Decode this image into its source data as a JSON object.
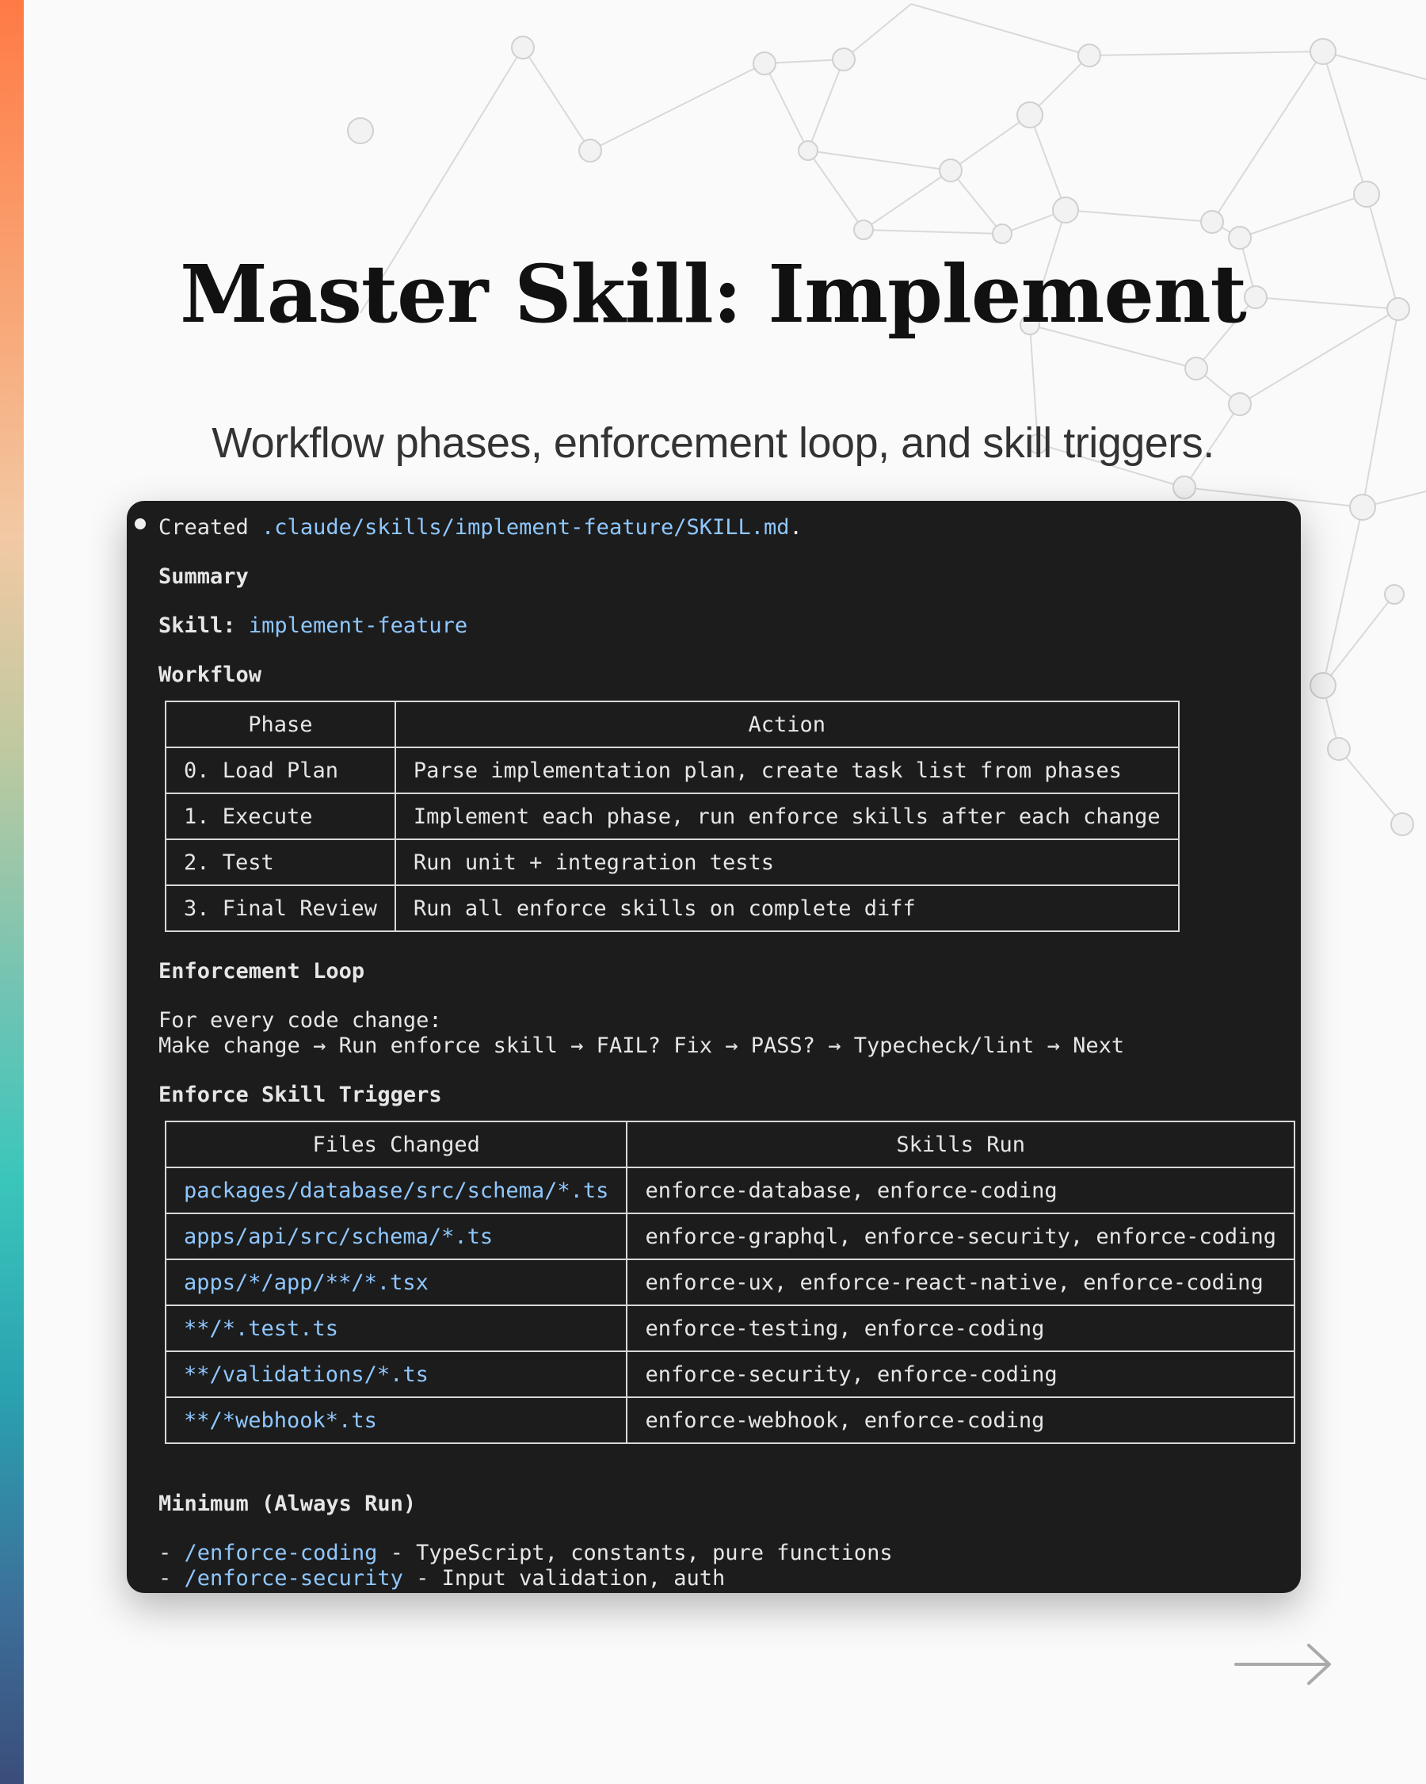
{
  "slide": {
    "title": "Master Skill: Implement",
    "subtitle": "Workflow phases, enforcement loop, and skill triggers."
  },
  "terminal": {
    "created_prefix": "Created ",
    "created_path": ".claude/skills/implement-feature/SKILL.md",
    "created_suffix": ".",
    "summary_heading": "Summary",
    "skill_label": "Skill:",
    "skill_name": "implement-feature",
    "workflow_heading": "Workflow",
    "workflow_table": {
      "headers": [
        "Phase",
        "Action"
      ],
      "rows": [
        [
          "0. Load Plan",
          "Parse implementation plan, create task list from phases"
        ],
        [
          "1. Execute",
          "Implement each phase, run enforce skills after each change"
        ],
        [
          "2. Test",
          "Run unit + integration tests"
        ],
        [
          "3. Final Review",
          "Run all enforce skills on complete diff"
        ]
      ]
    },
    "enforcement_heading": "Enforcement Loop",
    "enforcement_line1": "For every code change:",
    "enforcement_line2": "Make change → Run enforce skill → FAIL? Fix → PASS? → Typecheck/lint → Next",
    "triggers_heading": "Enforce Skill Triggers",
    "triggers_table": {
      "headers": [
        "Files Changed",
        "Skills Run"
      ],
      "rows": [
        [
          "packages/database/src/schema/*.ts",
          "enforce-database, enforce-coding"
        ],
        [
          "apps/api/src/schema/*.ts",
          "enforce-graphql, enforce-security, enforce-coding"
        ],
        [
          "apps/*/app/**/*.tsx",
          "enforce-ux, enforce-react-native, enforce-coding"
        ],
        [
          "**/*.test.ts",
          "enforce-testing, enforce-coding"
        ],
        [
          "**/validations/*.ts",
          "enforce-security, enforce-coding"
        ],
        [
          "**/*webhook*.ts",
          "enforce-webhook, enforce-coding"
        ]
      ]
    },
    "minimum_heading": "Minimum (Always Run)",
    "minimum_items": [
      {
        "dash": "- ",
        "cmd": "/enforce-coding",
        "desc": " - TypeScript, constants, pure functions"
      },
      {
        "dash": "- ",
        "cmd": "/enforce-security",
        "desc": " - Input validation, auth"
      }
    ]
  },
  "icons": {
    "next": "arrow-right-icon",
    "bullet": "bullet-icon"
  },
  "colors": {
    "terminal_bg": "#1c1c1c",
    "link": "#8fc7ff",
    "text": "#e6e6e6",
    "gradient_top": "#ff7a45",
    "gradient_mid": "#3bc6bb",
    "gradient_bottom": "#3b4d7a"
  }
}
